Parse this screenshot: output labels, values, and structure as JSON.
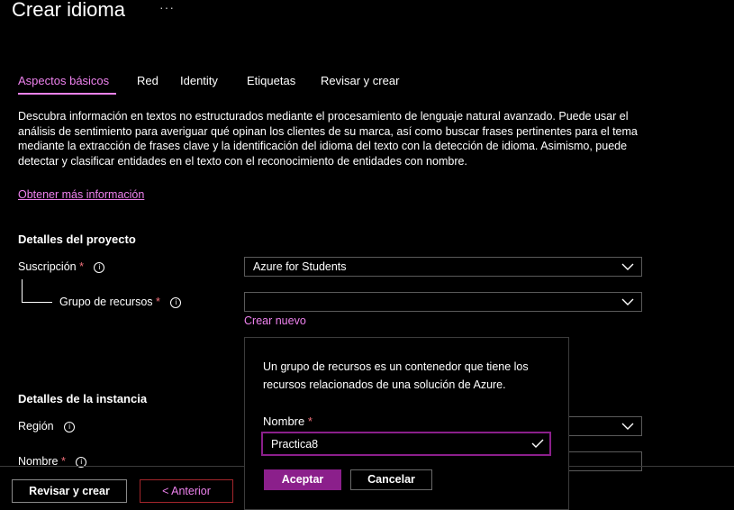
{
  "header": {
    "title": "Crear idioma",
    "more_label": "···"
  },
  "tabs": [
    {
      "label": "Aspectos básicos",
      "active": true
    },
    {
      "label": "Red",
      "active": false
    },
    {
      "label": "Identity",
      "active": false
    },
    {
      "label": "Etiquetas",
      "active": false
    },
    {
      "label": "Revisar y crear",
      "active": false
    }
  ],
  "intro": {
    "description": "Descubra información en textos no estructurados mediante el procesamiento de lenguaje natural avanzado. Puede usar el análisis de sentimiento para averiguar qué opinan los clientes de su marca, así como buscar frases pertinentes para el tema mediante la extracción de frases clave y la identificación del idioma del texto con la detección de idioma. Asimismo, puede detectar y clasificar entidades en el texto con el reconocimiento de entidades con nombre.",
    "learn_more": "Obtener más información"
  },
  "project": {
    "heading": "Detalles del proyecto",
    "subscription_label": "Suscripción",
    "subscription_value": "Azure for Students",
    "resource_group_label": "Grupo de recursos",
    "resource_group_value": "",
    "create_new": "Crear nuevo",
    "required_mark": "*",
    "info_glyph": "i"
  },
  "instance": {
    "heading": "Detalles de la instancia",
    "region_label": "Región",
    "name_label": "Nombre"
  },
  "popup": {
    "text": "Un grupo de recursos es un contenedor que tiene los recursos relacionados de una solución de Azure.",
    "name_label": "Nombre",
    "name_value": "Practica8",
    "ok_label": "Aceptar",
    "cancel_label": "Cancelar"
  },
  "footer": {
    "review_label": "Revisar y crear",
    "previous_label": "< Anterior"
  },
  "icons": {
    "dropdown": "chevron-down-icon",
    "info": "info-icon",
    "valid": "checkmark-icon"
  },
  "colors": {
    "accent": "#ee82ee",
    "primary_button": "#8b1f8b",
    "required": "#f1707b",
    "background": "#000000"
  }
}
